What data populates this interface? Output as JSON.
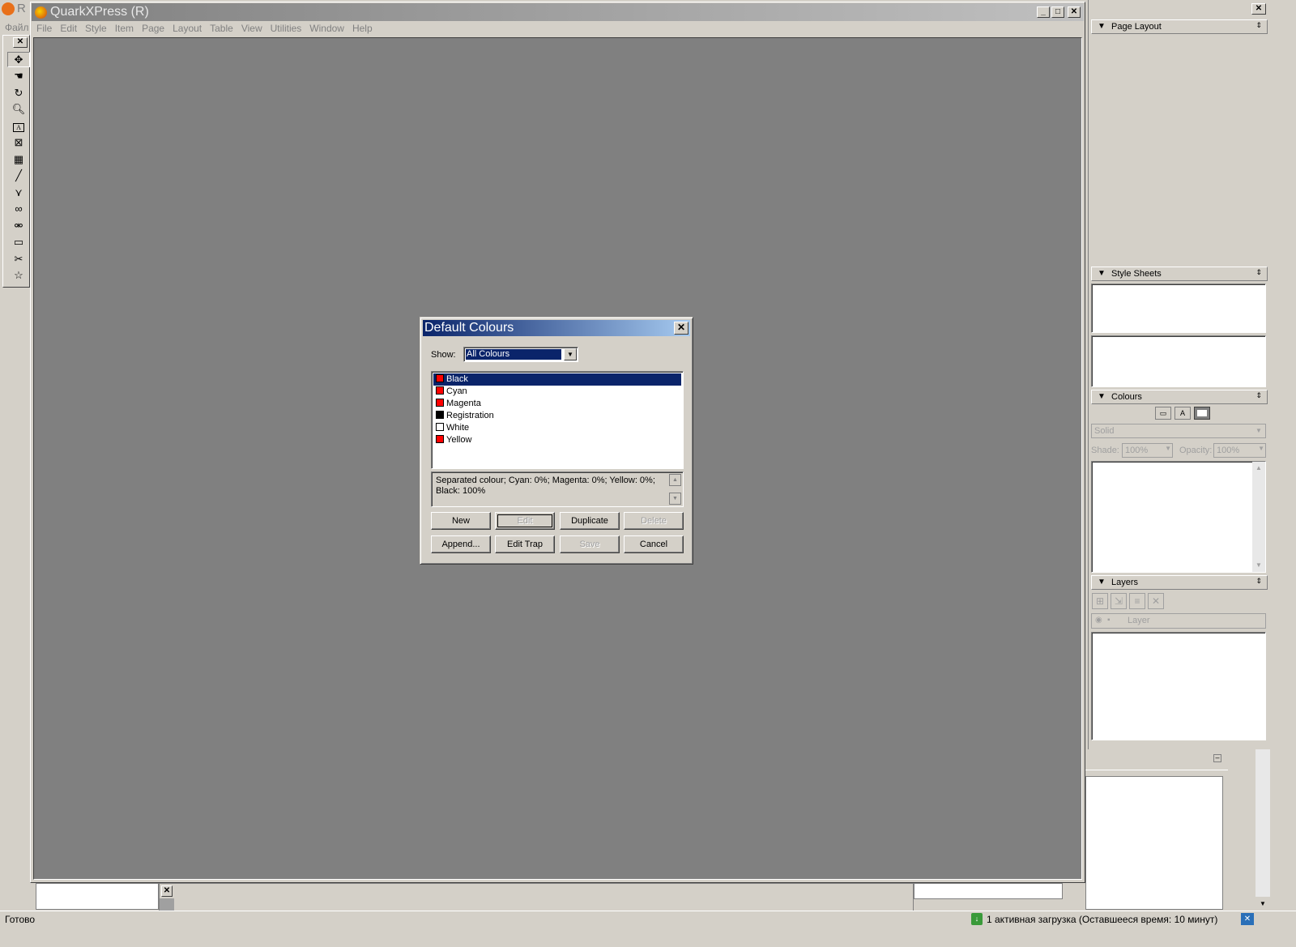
{
  "bg_app": {
    "letter": "R",
    "menu_first": "Файл"
  },
  "window": {
    "title": "QuarkXPress (R)"
  },
  "menu": [
    "File",
    "Edit",
    "Style",
    "Item",
    "Page",
    "Layout",
    "Table",
    "View",
    "Utilities",
    "Window",
    "Help"
  ],
  "tools": [
    "move-icon",
    "content-icon",
    "rotate-icon",
    "zoom-icon",
    "text-box-icon",
    "picture-box-icon",
    "table-icon",
    "line-icon",
    "bezier-line-icon",
    "link-icon",
    "unlink-icon",
    "composition-zones-icon",
    "scissors-icon",
    "star-icon"
  ],
  "palettes": {
    "page_layout": {
      "title": "Page Layout"
    },
    "style_sheets": {
      "title": "Style Sheets"
    },
    "colours": {
      "title": "Colours",
      "fill": "Solid",
      "shade_label": "Shade:",
      "shade_value": "100%",
      "opacity_label": "Opacity:",
      "opacity_value": "100%"
    },
    "layers": {
      "title": "Layers",
      "column_label": "Layer"
    }
  },
  "dialog": {
    "title": "Default Colours",
    "show_label": "Show:",
    "show_value": "All Colours",
    "colors": [
      {
        "name": "Black",
        "swatch": "#ff0000",
        "selected": true
      },
      {
        "name": "Cyan",
        "swatch": "#ff0000",
        "selected": false
      },
      {
        "name": "Magenta",
        "swatch": "#ff0000",
        "selected": false
      },
      {
        "name": "Registration",
        "swatch": "#000000",
        "selected": false
      },
      {
        "name": "White",
        "swatch": "#ffffff",
        "selected": false
      },
      {
        "name": "Yellow",
        "swatch": "#ff0000",
        "selected": false
      }
    ],
    "description": "Separated colour; Cyan: 0%; Magenta: 0%; Yellow: 0%; Black: 100%",
    "buttons": {
      "new": "New",
      "edit": "Edit",
      "duplicate": "Duplicate",
      "delete": "Delete",
      "append": "Append...",
      "edit_trap": "Edit Trap",
      "save": "Save",
      "cancel": "Cancel"
    }
  },
  "statusbar": {
    "ready": "Готово",
    "download": "1 активная загрузка (Оставшееся время: 10 минут)"
  },
  "colors": {
    "workspace": "#808080",
    "selection": "#0a246a",
    "chrome": "#d4d0c8"
  }
}
